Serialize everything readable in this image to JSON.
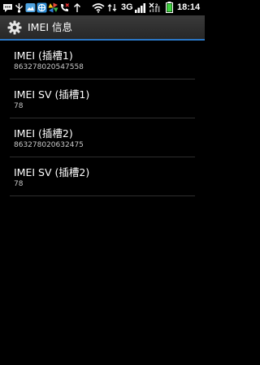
{
  "status_bar": {
    "network_type": "3G",
    "time": "18:14",
    "icons": [
      "chat-bubble-icon",
      "usb-icon",
      "gallery-icon",
      "browser-icon",
      "pinwheel-icon",
      "missed-call-icon",
      "upload-arrow-icon",
      "wifi-icon",
      "no-sim-icon",
      "battery-icon"
    ]
  },
  "action_bar": {
    "title": "IMEI 信息",
    "icon": "settings-gear-icon",
    "accent_color": "#2b78c8"
  },
  "items": [
    {
      "title": "IMEI (插槽1)",
      "value": "863278020547558"
    },
    {
      "title": "IMEI SV (插槽1)",
      "value": "78"
    },
    {
      "title": "IMEI (插槽2)",
      "value": "863278020632475"
    },
    {
      "title": "IMEI SV (插槽2)",
      "value": "78"
    }
  ]
}
